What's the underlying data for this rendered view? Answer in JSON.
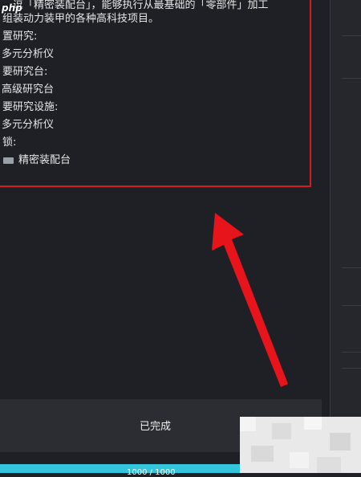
{
  "info": {
    "lines": [
      "逗「精密装配台」，能够执行从最基础的「零部件」加工",
      "组装动力装甲的各种高科技项目。",
      "置研究:",
      "多元分析仪",
      "要研究台:",
      "高级研究台",
      "要研究设施:",
      "多元分析仪",
      "锁:",
      "精密装配台"
    ],
    "watermark": "php"
  },
  "status": {
    "label": "已完成"
  },
  "progress": {
    "text": "1000 / 1000",
    "fraction": 1.0
  },
  "colors": {
    "highlight_border": "#d21c24",
    "arrow": "#e8141b",
    "progress": "#32c5dc"
  },
  "icons": {
    "unlock_item": "item-thumbnail-icon"
  }
}
